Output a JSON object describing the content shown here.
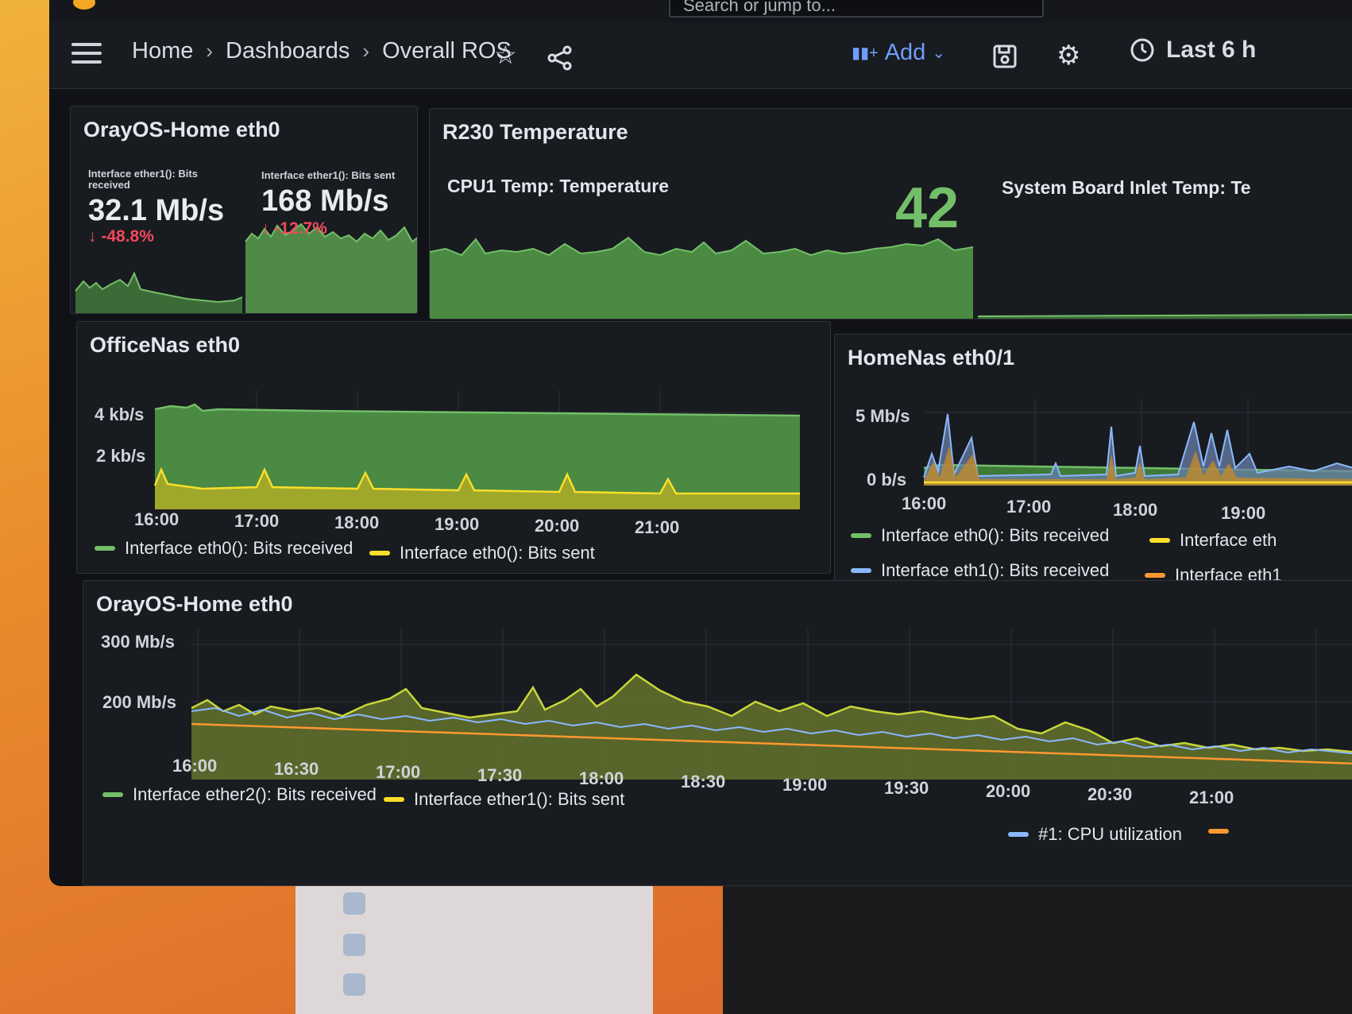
{
  "header": {
    "search_placeholder": "Search or jump to...",
    "breadcrumbs": [
      "Home",
      "Dashboards",
      "Overall ROS"
    ],
    "add_label": "Add",
    "time_range": "Last 6 h"
  },
  "panels": {
    "oray_stat": {
      "title": "OrayOS-Home eth0",
      "received_label": "Interface ether1(): Bits received",
      "received_value": "32.1 Mb/s",
      "received_delta": "-48.8%",
      "sent_label": "Interface ether1(): Bits sent",
      "sent_value": "168 Mb/s",
      "sent_delta": "-12.7%"
    },
    "r230": {
      "title": "R230 Temperature",
      "cpu_label": "CPU1 Temp: Temperature",
      "cpu_value": "42",
      "inlet_label": "System Board Inlet Temp: Te"
    },
    "officenas": {
      "title": "OfficeNas eth0",
      "legend_received": "Interface eth0(): Bits received",
      "legend_sent": "Interface eth0(): Bits sent"
    },
    "homenas": {
      "title": "HomeNas eth0/1",
      "legend": [
        "Interface eth0(): Bits received",
        "Interface eth",
        "Interface eth1(): Bits received",
        "Interface eth1"
      ]
    },
    "oray_ts": {
      "title": "OrayOS-Home eth0",
      "legend": [
        "Interface ether2(): Bits received",
        "Interface ether1(): Bits sent",
        "#1: CPU utilization"
      ]
    }
  },
  "colors": {
    "green": "#73bf69",
    "yellow": "#fade2a",
    "blue": "#8ab8ff",
    "orange": "#ff9830",
    "red": "#f2495c"
  },
  "chart_data": [
    {
      "type": "area",
      "title": "OfficeNas eth0",
      "x": [
        "16:00",
        "17:00",
        "18:00",
        "19:00",
        "20:00",
        "21:00"
      ],
      "yticks": [
        "4 kb/s",
        "2 kb/s"
      ],
      "series": [
        {
          "name": "Interface eth0(): Bits received",
          "values": [
            4.1,
            4.0,
            4.0,
            3.9,
            3.9,
            3.8
          ]
        },
        {
          "name": "Interface eth0(): Bits sent",
          "values": [
            1.4,
            1.0,
            1.0,
            1.0,
            1.0,
            0.9
          ]
        }
      ]
    },
    {
      "type": "area",
      "title": "HomeNas eth0/1",
      "x": [
        "16:00",
        "17:00",
        "18:00",
        "19:00"
      ],
      "yticks": [
        "5 Mb/s",
        "0 b/s"
      ],
      "series": [
        {
          "name": "Interface eth0(): Bits received",
          "values": [
            0.5,
            0.5,
            0.5,
            0.4
          ]
        },
        {
          "name": "Interface eth1(): Bits received",
          "values": [
            0.3,
            0.6,
            0.3,
            1.5
          ]
        }
      ]
    },
    {
      "type": "area",
      "title": "OrayOS-Home eth0",
      "x": [
        "16:00",
        "16:30",
        "17:00",
        "17:30",
        "18:00",
        "18:30",
        "19:00",
        "19:30",
        "20:00",
        "20:30",
        "21:00"
      ],
      "yticks": [
        "300 Mb/s",
        "200 Mb/s"
      ],
      "series": [
        {
          "name": "Interface ether2(): Bits received",
          "values": [
            190,
            185,
            200,
            180,
            210,
            215,
            190,
            175,
            150,
            140,
            135
          ]
        },
        {
          "name": "Interface ether1(): Bits sent",
          "values": [
            185,
            180,
            170,
            165,
            175,
            170,
            160,
            150,
            140,
            130,
            125
          ]
        },
        {
          "name": "#1: CPU utilization",
          "values": [
            170,
            168,
            166,
            164,
            162,
            160,
            158,
            156,
            154,
            152,
            150
          ]
        }
      ]
    }
  ]
}
